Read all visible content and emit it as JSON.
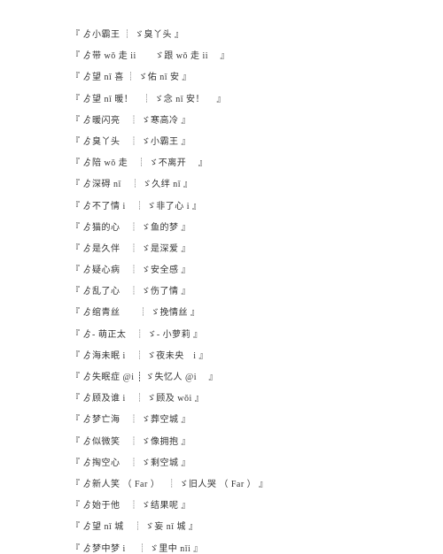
{
  "rows": [
    "『 ゟ小霸王 ┊ ゞ臭丫头 』",
    "『 ゟ带 wǒ 走 ii　　ゞ跟 wǒ 走 ii　 』",
    "『 ゟ望 nǐ 喜 ┊ ゞ佑 nǐ 安 』",
    "『 ゟ望 nǐ 暖！　┊ ゞ念 nǐ 安！　 』",
    "『 ゟ暖闪亮　┊ ゞ寒高冷 』",
    "『 ゟ臭丫头　┊ ゞ小霸王 』",
    "『 ゟ陪 wǒ 走　┊ ゞ不离开　 』",
    "『 ゟ深碍 nǐ　┊ ゞ久绊 nǐ 』",
    "『 ゟ不了情 i　┊ ゞ非了心 i 』",
    "『 ゟ猫的心　┊ ゞ鱼的梦 』",
    "『 ゟ是久伴　┊ ゞ是深爱 』",
    "『 ゟ疑心病　┊ ゞ安全感 』",
    "『 ゟ乱了心　┊ ゞ伤了情 』",
    "『 ゟ绾青丝　　┊ ゞ挽情丝 』",
    "『 ゟ- 萌正太　┊ ゞ- 小萝莉 』",
    "『 ゟ海未眠 i　┊ ゞ夜未央　i 』",
    "『 ゟ失眠症 @i ┊ ゞ失忆人 @i　 』",
    "『 ゟ顾及谁 i　┊ ゞ顾及 wǒi 』",
    "『 ゟ梦亡海　┊ ゞ葬空城 』",
    "『 ゟ似微笑　┊ ゞ像拥抱 』",
    "『 ゟ掏空心　┊ ゞ剩空城 』",
    "『 ゟ新人笑 （ Far ）　 ┊ ゞ旧人哭 （ Far ） 』",
    "『 ゟ始于他　┊ ゞ结果呢 』",
    "『 ゟ望 nǐ 城　┊ ゞ妄 nǐ 城 』",
    "『 ゟ梦中梦 i 　┊ ゞ里中 nǐi 』"
  ]
}
